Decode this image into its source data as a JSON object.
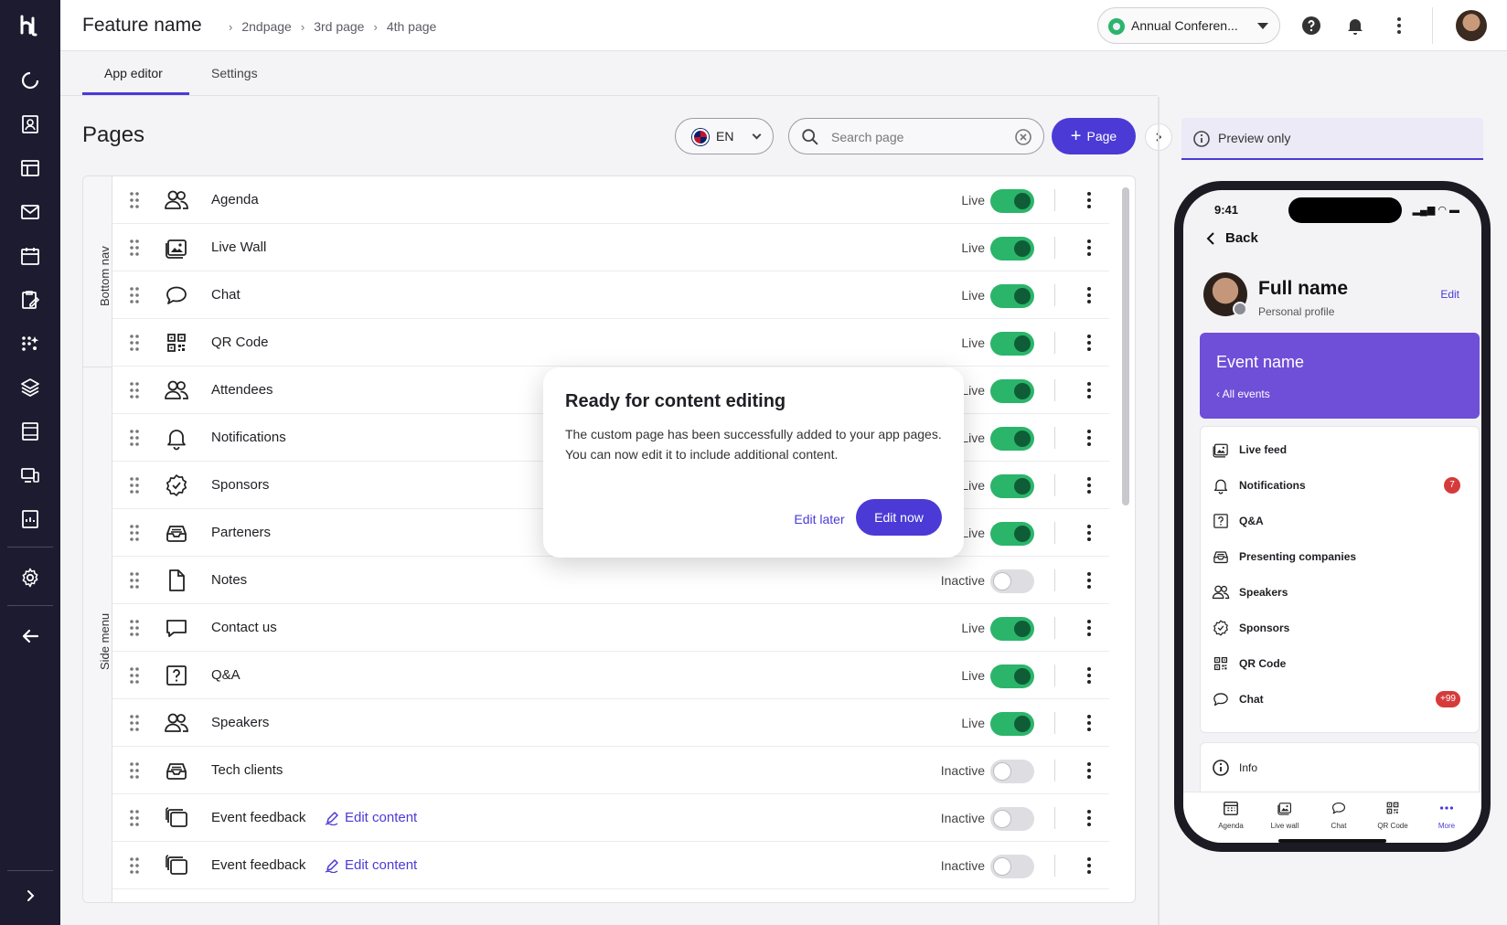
{
  "header": {
    "feature_title": "Feature name",
    "breadcrumbs": [
      "2ndpage",
      "3rd page",
      "4th page"
    ],
    "event_select": "Annual Conferen...",
    "icons": [
      "help-icon",
      "bell-icon",
      "kebab-icon"
    ]
  },
  "tabs": [
    {
      "label": "App editor",
      "active": true
    },
    {
      "label": "Settings",
      "active": false
    }
  ],
  "pages": {
    "title": "Pages",
    "language": "EN",
    "search_placeholder": "Search page",
    "add_page_label": "Page",
    "groups": [
      "Bottom nav",
      "Side menu"
    ],
    "rows": [
      {
        "name": "Agenda",
        "status": "Live",
        "enabled": true,
        "icon": "people-icon"
      },
      {
        "name": "Live Wall",
        "status": "Live",
        "enabled": true,
        "icon": "image-icon"
      },
      {
        "name": "Chat",
        "status": "Live",
        "enabled": true,
        "icon": "chat-icon"
      },
      {
        "name": "QR Code",
        "status": "Live",
        "enabled": true,
        "icon": "qr-icon"
      },
      {
        "name": "Attendees",
        "status": "Live",
        "enabled": true,
        "icon": "people-icon"
      },
      {
        "name": "Notifications",
        "status": "Live",
        "enabled": true,
        "icon": "bell-icon"
      },
      {
        "name": "Sponsors",
        "status": "Live",
        "enabled": true,
        "icon": "badge-check-icon"
      },
      {
        "name": "Parteners",
        "status": "Live",
        "enabled": true,
        "icon": "inbox-icon"
      },
      {
        "name": "Notes",
        "status": "Inactive",
        "enabled": false,
        "icon": "file-icon"
      },
      {
        "name": "Contact us",
        "status": "Live",
        "enabled": true,
        "icon": "message-square-icon"
      },
      {
        "name": "Q&A",
        "status": "Live",
        "enabled": true,
        "icon": "question-square-icon"
      },
      {
        "name": "Speakers",
        "status": "Live",
        "enabled": true,
        "icon": "people-icon"
      },
      {
        "name": "Tech clients",
        "status": "Inactive",
        "enabled": false,
        "icon": "inbox-icon"
      },
      {
        "name": "Event feedback",
        "status": "Inactive",
        "enabled": false,
        "icon": "layers-icon",
        "edit_link": "Edit content"
      },
      {
        "name": "Event feedback",
        "status": "Inactive",
        "enabled": false,
        "icon": "layers-icon",
        "edit_link": "Edit content"
      }
    ]
  },
  "modal": {
    "title": "Ready for content editing",
    "body": "The custom page has been successfully added to your app pages. You can now edit it to include additional content.",
    "secondary": "Edit later",
    "primary": "Edit now"
  },
  "preview": {
    "label": "Preview only",
    "phone": {
      "time": "9:41",
      "back": "Back",
      "full_name": "Full name",
      "subtitle": "Personal profile",
      "edit": "Edit",
      "event_name": "Event name",
      "all_events": "All events",
      "menu": [
        {
          "label": "Live feed",
          "icon": "image-icon"
        },
        {
          "label": "Notifications",
          "icon": "bell-icon",
          "badge": "7"
        },
        {
          "label": "Q&A",
          "icon": "question-square-icon"
        },
        {
          "label": "Presenting companies",
          "icon": "inbox-icon"
        },
        {
          "label": "Speakers",
          "icon": "people-icon"
        },
        {
          "label": "Sponsors",
          "icon": "badge-check-icon"
        },
        {
          "label": "QR Code",
          "icon": "qr-icon"
        },
        {
          "label": "Chat",
          "icon": "chat-icon",
          "badge": "+99"
        }
      ],
      "info": "Info",
      "tabbar": [
        {
          "label": "Agenda",
          "icon": "calendar-grid-icon"
        },
        {
          "label": "Live wall",
          "icon": "image-icon"
        },
        {
          "label": "Chat",
          "icon": "chat-icon"
        },
        {
          "label": "QR Code",
          "icon": "qr-icon"
        },
        {
          "label": "More",
          "icon": "more-dots-icon",
          "active": true
        }
      ]
    }
  },
  "colors": {
    "accent": "#4b3ad6",
    "live_toggle": "#2bb56a",
    "rail": "#1c1b30"
  }
}
